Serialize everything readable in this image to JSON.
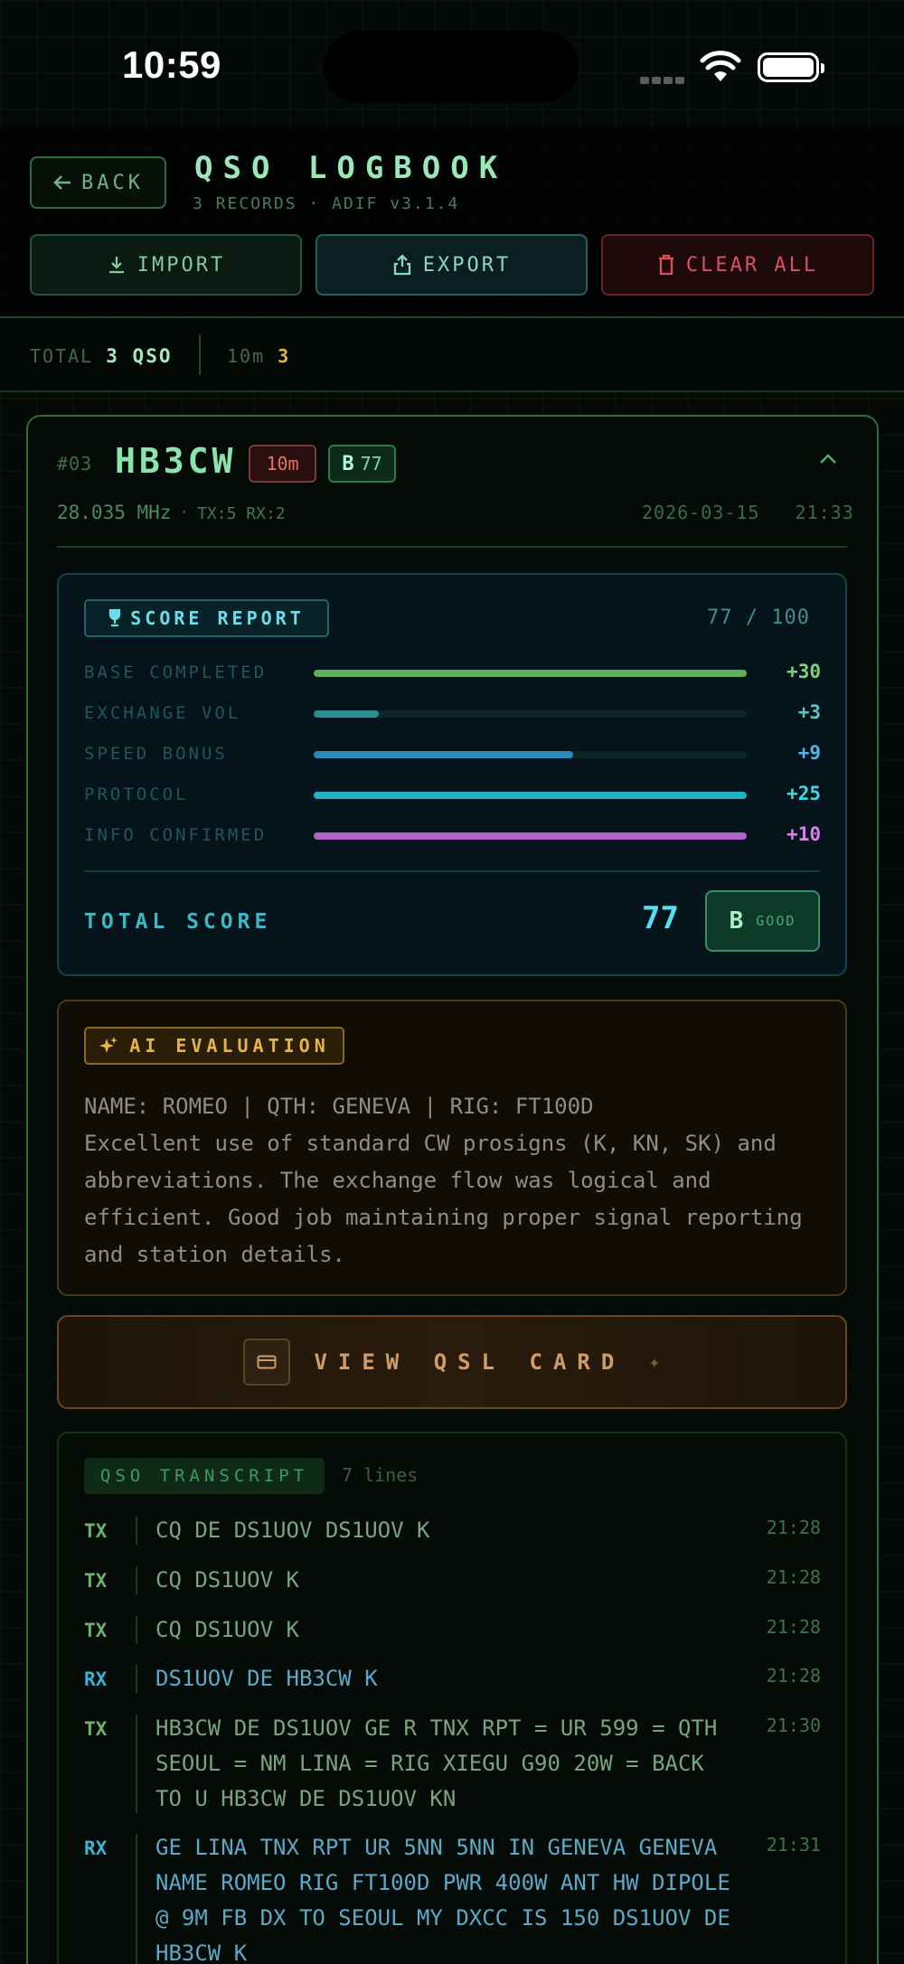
{
  "status_bar": {
    "time": "10:59"
  },
  "header": {
    "back_label": "BACK",
    "title": "QSO LOGBOOK",
    "subtitle": "3 RECORDS · ADIF v3.1.4",
    "import_label": "IMPORT",
    "export_label": "EXPORT",
    "clear_label": "CLEAR ALL"
  },
  "stats": {
    "total_label": "TOTAL",
    "total_value": "3 QSO",
    "band_label": "10m",
    "band_value": "3"
  },
  "card": {
    "number": "#03",
    "callsign": "HB3CW",
    "band": "10m",
    "grade": "B",
    "grade_score": "77",
    "frequency": "28.035 MHz",
    "separator": "·",
    "tx_rx": "TX:5 RX:2",
    "date": "2026-03-15",
    "time": "21:33"
  },
  "score": {
    "tag": "SCORE REPORT",
    "of_total": "77 / 100",
    "rows": [
      {
        "label": "BASE COMPLETED",
        "value": "+30",
        "fraction": 1.0,
        "color": "#5fae5a",
        "value_color": "#7fd17a"
      },
      {
        "label": "EXCHANGE VOL",
        "value": "+3",
        "fraction": 0.15,
        "color": "#2a8f94",
        "value_color": "#5cc3c8"
      },
      {
        "label": "SPEED BONUS",
        "value": "+9",
        "fraction": 0.6,
        "color": "#2b8ab8",
        "value_color": "#4fb8e8"
      },
      {
        "label": "PROTOCOL",
        "value": "+25",
        "fraction": 1.0,
        "color": "#1fb3c4",
        "value_color": "#3ed8e8"
      },
      {
        "label": "INFO CONFIRMED",
        "value": "+10",
        "fraction": 1.0,
        "color": "#b062c9",
        "value_color": "#e07ef2"
      }
    ],
    "total_label": "TOTAL SCORE",
    "total_value": "77",
    "grade": "B",
    "grade_word": "GOOD"
  },
  "ai": {
    "tag": "AI EVALUATION",
    "text": "NAME: ROMEO | QTH: GENEVA | RIG: FT100D\nExcellent use of standard CW prosigns (K, KN, SK) and abbreviations. The exchange flow was logical and efficient. Good job maintaining proper signal reporting and station details."
  },
  "qsl": {
    "label": "VIEW QSL CARD",
    "spark": "✦"
  },
  "transcript": {
    "tag": "QSO TRANSCRIPT",
    "count": "7 lines",
    "lines": [
      {
        "dir": "TX",
        "text": "CQ DE DS1UOV DS1UOV K",
        "time": "21:28"
      },
      {
        "dir": "TX",
        "text": "CQ DS1UOV K",
        "time": "21:28"
      },
      {
        "dir": "TX",
        "text": "CQ DS1UOV K",
        "time": "21:28"
      },
      {
        "dir": "RX",
        "text": "DS1UOV DE HB3CW K",
        "time": "21:28"
      },
      {
        "dir": "TX",
        "text": "HB3CW DE DS1UOV GE R TNX RPT = UR 599 = QTH SEOUL = NM LINA = RIG XIEGU G90 20W = BACK TO U HB3CW DE DS1UOV KN",
        "time": "21:30"
      },
      {
        "dir": "RX",
        "text": "GE LINA TNX RPT UR 5NN 5NN IN GENEVA GENEVA NAME ROMEO RIG FT100D PWR 400W ANT HW DIPOLE @ 9M FB DX TO SEOUL MY DXCC IS 150 DS1UOV DE HB3CW K",
        "time": "21:31"
      }
    ]
  },
  "colors": {
    "tx": "#6faf72",
    "rx": "#3fb0d8",
    "tx_text": "#7aa382",
    "rx_text": "#5fa9c8"
  }
}
